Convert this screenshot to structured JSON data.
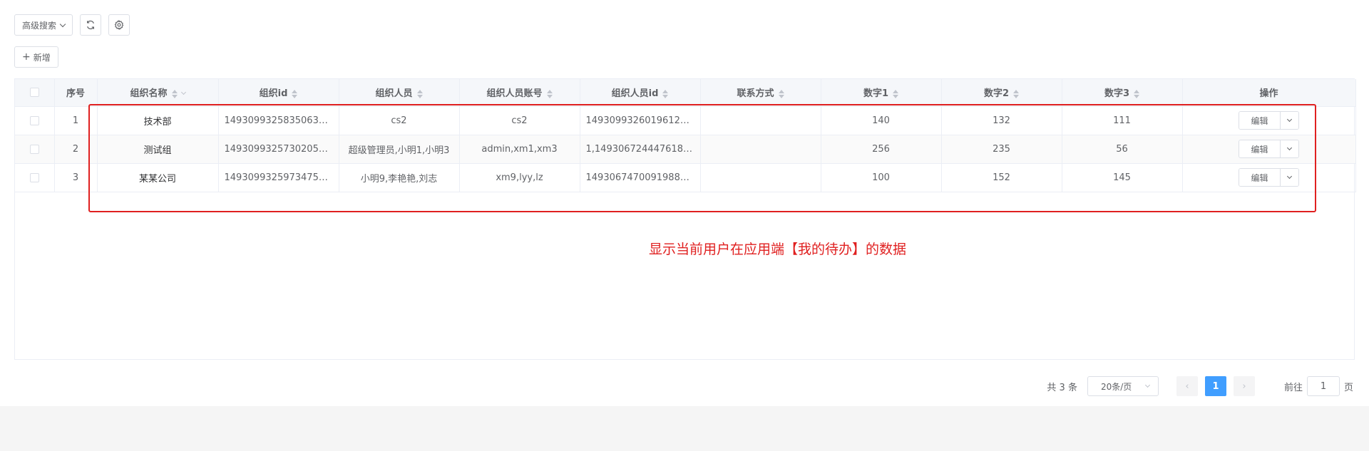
{
  "toolbar": {
    "advanced_search_label": "高级搜索",
    "refresh_icon": "refresh-icon",
    "settings_icon": "gear-icon",
    "add_label": "新增"
  },
  "table": {
    "columns": [
      "序号",
      "组织名称",
      "组织id",
      "组织人员",
      "组织人员账号",
      "组织人员id",
      "联系方式",
      "数字1",
      "数字2",
      "数字3",
      "操作"
    ],
    "rows": [
      {
        "index": "1",
        "name": "技术部",
        "org_id": "1493099325835063296",
        "members": "cs2",
        "accounts": "cs2",
        "member_ids": "1493099326019612673",
        "contact": "",
        "num1": "140",
        "num2": "132",
        "num3": "111"
      },
      {
        "index": "2",
        "name": "测试组",
        "org_id": "1493099325730205696",
        "members": "超级管理员,小明1,小明3",
        "accounts": "admin,xm1,xm3",
        "member_ids": "1,1493067244476182...",
        "contact": "",
        "num1": "256",
        "num2": "235",
        "num3": "56"
      },
      {
        "index": "3",
        "name": "某某公司",
        "org_id": "1493099325973475329",
        "members": "小明9,李艳艳,刘志",
        "accounts": "xm9,lyy,lz",
        "member_ids": "14930674700919889...",
        "contact": "",
        "num1": "100",
        "num2": "152",
        "num3": "145"
      }
    ],
    "edit_label": "编辑"
  },
  "annotation": {
    "note": "显示当前用户在应用端【我的待办】的数据",
    "color": "#e02020"
  },
  "pagination": {
    "total": "共 3 条",
    "page_size": "20条/页",
    "current_page": "1",
    "goto_prefix": "前往",
    "goto_value": "1",
    "goto_suffix": "页"
  },
  "colors": {
    "primary": "#409eff",
    "border": "#ebeef5",
    "header_bg": "#f5f7fa"
  }
}
